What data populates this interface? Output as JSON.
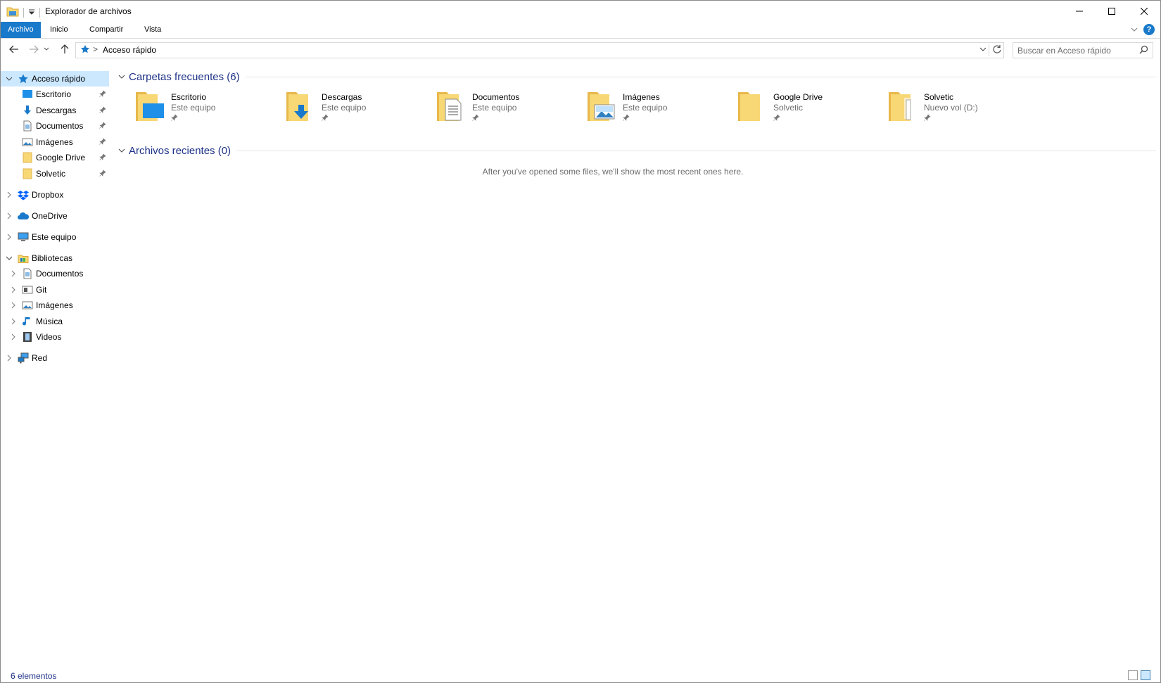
{
  "window": {
    "title": "Explorador de archivos"
  },
  "ribbon": {
    "tabs": [
      {
        "label": "Archivo",
        "active": true
      },
      {
        "label": "Inicio",
        "active": false
      },
      {
        "label": "Compartir",
        "active": false
      },
      {
        "label": "Vista",
        "active": false
      }
    ],
    "help_label": "?"
  },
  "navbar": {
    "address": {
      "crumb": "Acceso rápido",
      "separator": ">"
    },
    "search": {
      "placeholder": "Buscar en Acceso rápido"
    }
  },
  "sidebar": {
    "quick_access": {
      "label": "Acceso rápido",
      "items": [
        {
          "label": "Escritorio",
          "icon": "desktop-icon"
        },
        {
          "label": "Descargas",
          "icon": "downloads-icon"
        },
        {
          "label": "Documentos",
          "icon": "documents-icon"
        },
        {
          "label": "Imágenes",
          "icon": "pictures-icon"
        },
        {
          "label": "Google Drive",
          "icon": "folder-icon"
        },
        {
          "label": "Solvetic",
          "icon": "folder-icon"
        }
      ]
    },
    "roots": [
      {
        "label": "Dropbox",
        "icon": "dropbox-icon"
      },
      {
        "label": "OneDrive",
        "icon": "onedrive-icon"
      },
      {
        "label": "Este equipo",
        "icon": "computer-icon"
      }
    ],
    "libraries": {
      "label": "Bibliotecas",
      "items": [
        {
          "label": "Documentos",
          "icon": "documents-icon"
        },
        {
          "label": "Git",
          "icon": "git-icon"
        },
        {
          "label": "Imágenes",
          "icon": "pictures-icon"
        },
        {
          "label": "Música",
          "icon": "music-icon"
        },
        {
          "label": "Videos",
          "icon": "videos-icon"
        }
      ]
    },
    "network": {
      "label": "Red",
      "icon": "network-icon"
    }
  },
  "content": {
    "frequent": {
      "title": "Carpetas frecuentes (6)",
      "folders": [
        {
          "name": "Escritorio",
          "location": "Este equipo",
          "icon": "desktop-folder-icon"
        },
        {
          "name": "Descargas",
          "location": "Este equipo",
          "icon": "downloads-folder-icon"
        },
        {
          "name": "Documentos",
          "location": "Este equipo",
          "icon": "documents-folder-icon"
        },
        {
          "name": "Imágenes",
          "location": "Este equipo",
          "icon": "pictures-folder-icon"
        },
        {
          "name": "Google Drive",
          "location": "Solvetic",
          "icon": "folder-icon"
        },
        {
          "name": "Solvetic",
          "location": "Nuevo vol (D:)",
          "icon": "folder-icon"
        }
      ]
    },
    "recent": {
      "title": "Archivos recientes (0)",
      "empty_message": "After you've opened some files, we'll show the most recent ones here."
    }
  },
  "status": {
    "count": "6 elementos"
  },
  "colors": {
    "accent": "#1979ca",
    "selection": "#cce8ff",
    "group_title": "#1e3287",
    "folder": "#f8d775",
    "folder_dark": "#e8b84a"
  }
}
